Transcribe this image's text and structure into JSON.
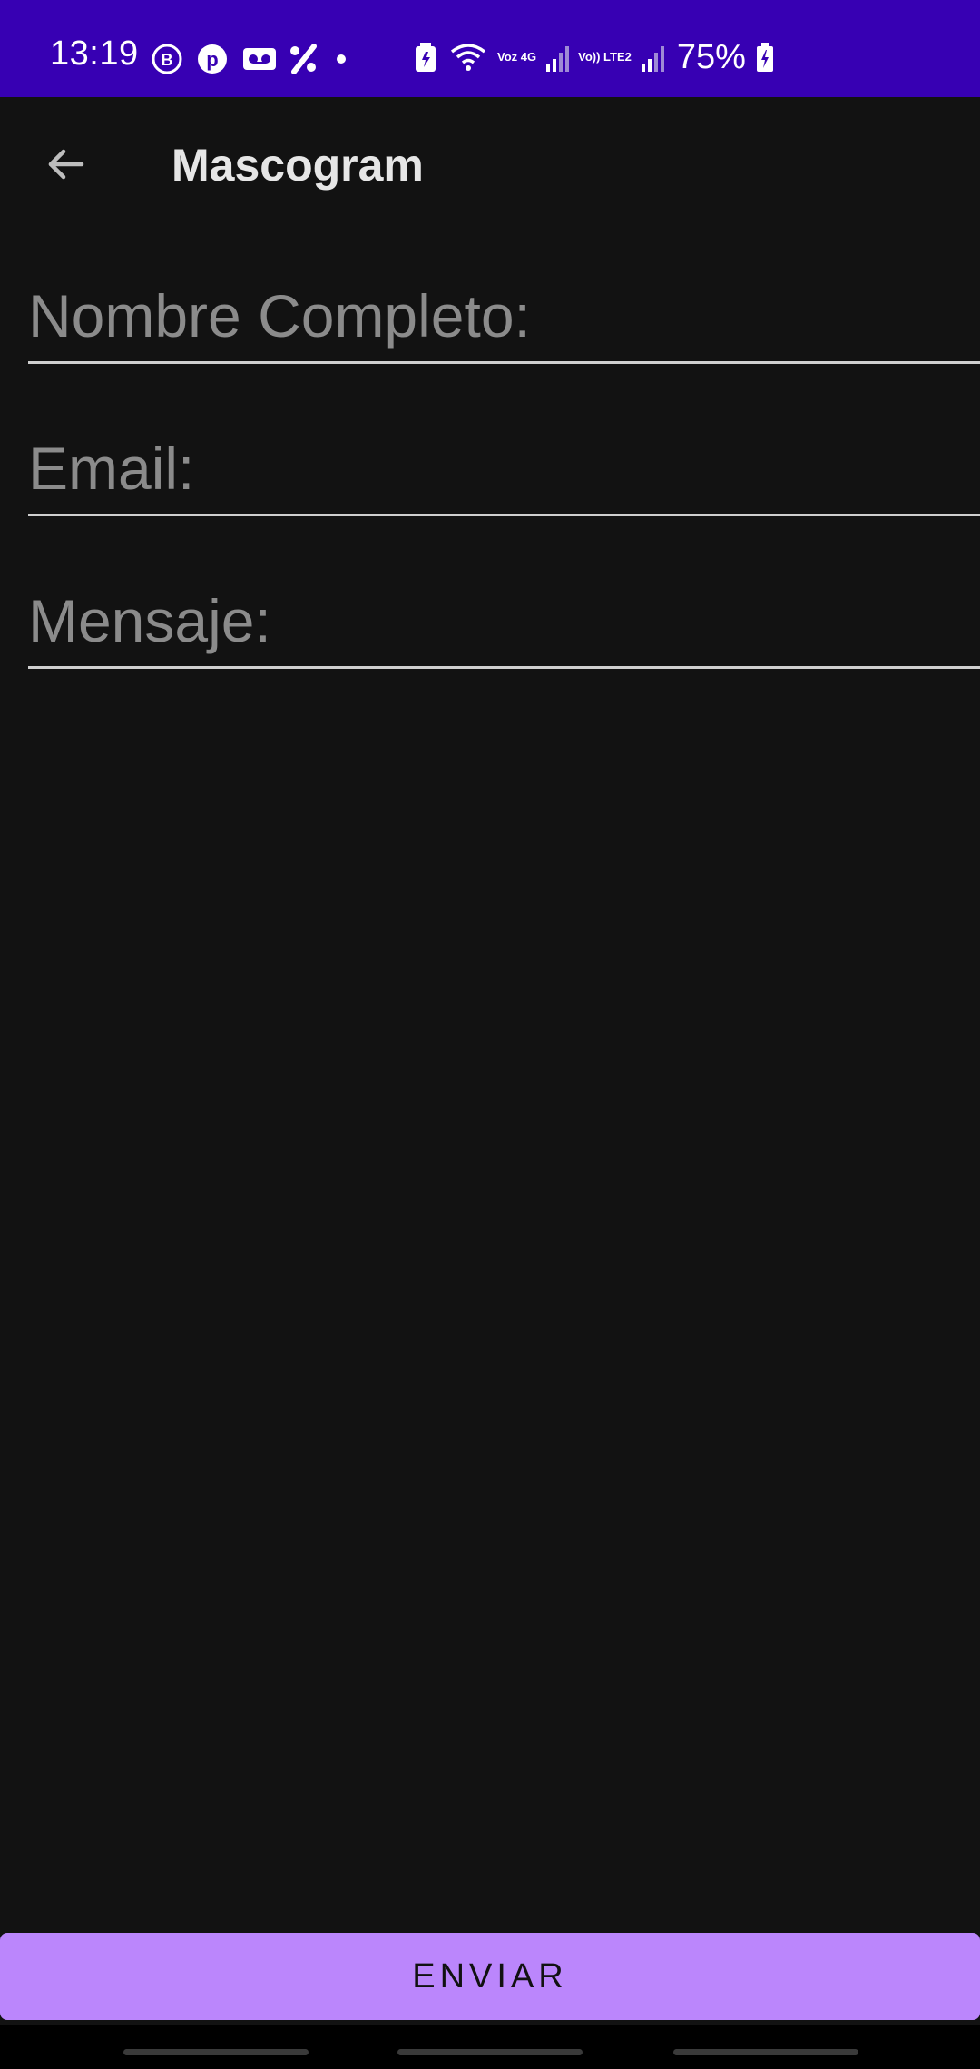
{
  "status_bar": {
    "time": "13:19",
    "battery_percent": "75%",
    "network_labels": [
      "Voz 4G",
      "Vo)) LTE2"
    ],
    "background_color": "#3700B3",
    "icons": [
      "b-circle-icon",
      "pinterest-icon",
      "voicemail-icon",
      "percent-icon",
      "dot-icon",
      "battery-saver-icon",
      "wifi-icon",
      "signal-icon",
      "signal-icon",
      "charging-battery-icon"
    ]
  },
  "toolbar": {
    "title": "Mascogram",
    "back_icon": "arrow-back-icon"
  },
  "form": {
    "name_placeholder": "Nombre Completo:",
    "email_placeholder": "Email:",
    "message_placeholder": "Mensaje:",
    "name_value": "",
    "email_value": "",
    "message_value": ""
  },
  "submit": {
    "label": "ENVIAR",
    "color": "#BB86FC"
  }
}
